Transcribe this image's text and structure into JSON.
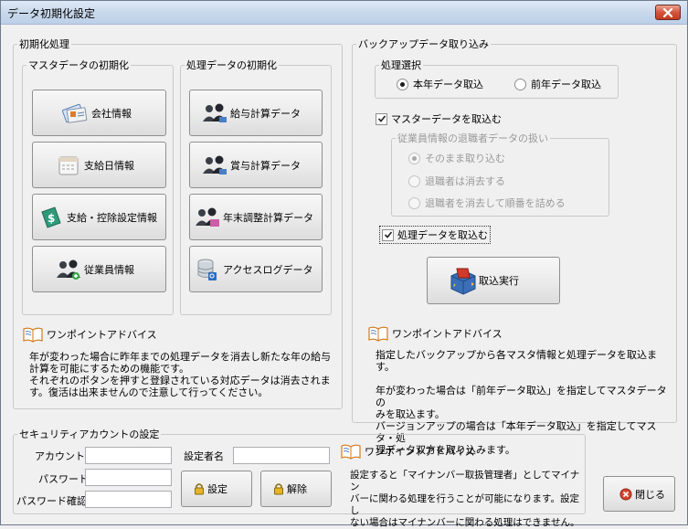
{
  "window": {
    "title": "データ初期化設定"
  },
  "init": {
    "legend": "初期化処理",
    "master": {
      "legend": "マスタデータの初期化",
      "buttons": [
        "会社情報",
        "支給日情報",
        "支給・控除設定情報",
        "従業員情報"
      ]
    },
    "processing": {
      "legend": "処理データの初期化",
      "buttons": [
        "給与計算データ",
        "賞与計算データ",
        "年末調整計算データ",
        "アクセスログデータ"
      ]
    },
    "advice_label": "ワンポイントアドバイス",
    "advice_lines": [
      "年が変わった場合に昨年までの処理データを消去し新たな年の給与",
      "計算を可能にするための機能です。",
      "それぞれのボタンを押すと登録されている対応データは消去されま",
      "す。復活は出来ませんので注意して行ってください。"
    ]
  },
  "backup": {
    "legend": "バックアップデータ取り込み",
    "select": {
      "legend": "処理選択",
      "options": [
        "本年データ取込",
        "前年データ取込"
      ],
      "selected": 0
    },
    "master_check": "マスターデータを取込む",
    "retired": {
      "legend": "従業員情報の退職者データの扱い",
      "options": [
        "そのまま取り込む",
        "退職者は消去する",
        "退職者を消去して順番を詰める"
      ],
      "selected": 0
    },
    "processing_check": "処理データを取込む",
    "import_button": "取込実行",
    "advice_label": "ワンポイントアドバイス",
    "advice_lines": [
      "指定したバックアップから各マスタ情報と処理データを取込ます。",
      "",
      "年が変わった場合は「前年データ取込」を指定してマスタデータの",
      "みを取込ます。",
      "バージョンアップの場合は「本年データ取込」を指定してマスタ・処",
      "理データ双方を取り込みます。"
    ]
  },
  "security": {
    "legend": "セキュリティアカウントの設定",
    "account_id_label": "アカウントID",
    "password_label": "パスワード",
    "password_confirm_label": "パスワード確認",
    "setter_name_label": "設定者名",
    "account_id_value": "",
    "password_value": "",
    "password_confirm_value": "",
    "setter_name_value": "",
    "set_button": "設定",
    "release_button": "解除",
    "advice_label": "ワンポイントアドバイス",
    "advice_lines": [
      "設定すると「マイナンバー取扱管理者」としてマイナン",
      "バーに関わる処理を行うことが可能になります。設定し",
      "ない場合はマイナンバーに関わる処理はできません。"
    ]
  },
  "close_button": "閉じる"
}
